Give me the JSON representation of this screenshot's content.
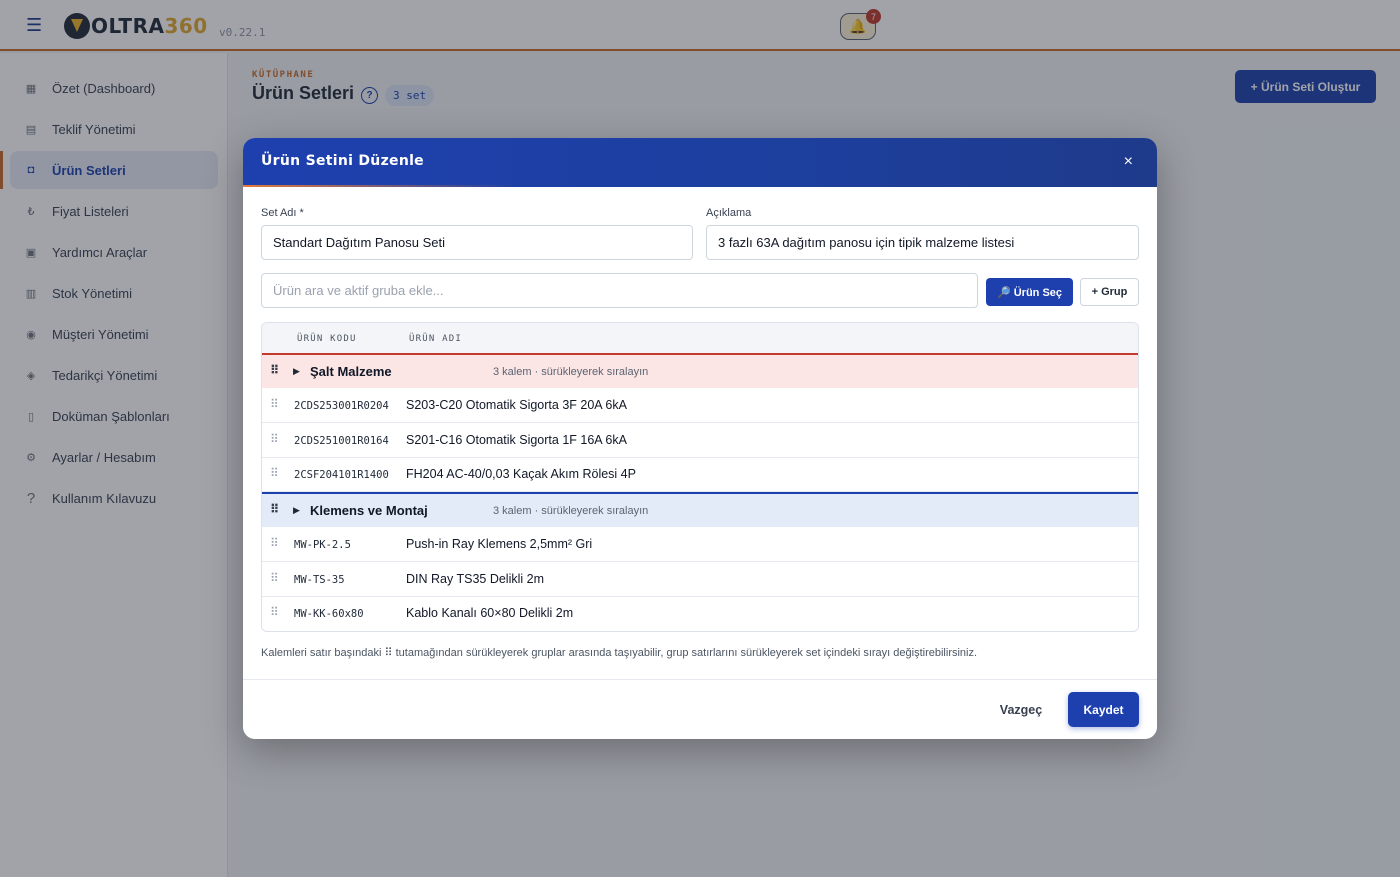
{
  "app": {
    "logo_prefix": "OLTRA",
    "logo_suffix": "360",
    "version": "v0.22.1",
    "notification_count": "7"
  },
  "sidebar": {
    "items": [
      {
        "label": "Özet (Dashboard)",
        "icon": "dashboard-icon",
        "active": false
      },
      {
        "label": "Teklif Yönetimi",
        "icon": "document-icon",
        "active": false
      },
      {
        "label": "Ürün Setleri",
        "icon": "box-icon",
        "active": true
      },
      {
        "label": "Fiyat Listeleri",
        "icon": "lira-icon",
        "active": false
      },
      {
        "label": "Yardımcı Araçlar",
        "icon": "toolbox-icon",
        "active": false
      },
      {
        "label": "Stok Yönetimi",
        "icon": "stock-icon",
        "active": false
      },
      {
        "label": "Müşteri Yönetimi",
        "icon": "customer-icon",
        "active": false
      },
      {
        "label": "Tedarikçi Yönetimi",
        "icon": "supplier-icon",
        "active": false
      },
      {
        "label": "Doküman Şablonları",
        "icon": "template-icon",
        "active": false
      },
      {
        "label": "Ayarlar / Hesabım",
        "icon": "settings-icon",
        "active": false
      },
      {
        "label": "Kullanım Kılavuzu",
        "icon": "question-icon",
        "active": false
      }
    ]
  },
  "page": {
    "eyebrow": "KÜTÜPHANE",
    "title": "Ürün Setleri",
    "help": "?",
    "count": "3 set",
    "create_button": "+ Ürün Seti Oluştur"
  },
  "modal": {
    "title": "Ürün Setini Düzenle",
    "close": "×",
    "set_name_label": "Set Adı *",
    "set_name_value": "Standart Dağıtım Panosu Seti",
    "description_label": "Açıklama",
    "description_value": "3 fazlı 63A dağıtım panosu için tipik malzeme listesi",
    "search_placeholder": "Ürün ara ve aktif gruba ekle...",
    "select_button": "🔎 Ürün Seç",
    "group_button": "+ Grup",
    "table": {
      "col_code": "ÜRÜN KODU",
      "col_name": "ÜRÜN ADI",
      "groups": [
        {
          "name": "Şalt Malzeme",
          "meta": "3 kalem · sürükleyerek sıralayın",
          "items": [
            {
              "code": "2CDS253001R0204",
              "name": "S203-C20 Otomatik Sigorta 3F 20A 6kA"
            },
            {
              "code": "2CDS251001R0164",
              "name": "S201-C16 Otomatik Sigorta 1F 16A 6kA"
            },
            {
              "code": "2CSF204101R1400",
              "name": "FH204 AC-40/0,03 Kaçak Akım Rölesi 4P"
            }
          ]
        },
        {
          "name": "Klemens ve Montaj",
          "meta": "3 kalem · sürükleyerek sıralayın",
          "items": [
            {
              "code": "MW-PK-2.5",
              "name": "Push-in Ray Klemens 2,5mm² Gri"
            },
            {
              "code": "MW-TS-35",
              "name": "DIN Ray TS35 Delikli 2m"
            },
            {
              "code": "MW-KK-60x80",
              "name": "Kablo Kanalı 60×80 Delikli 2m"
            }
          ]
        }
      ]
    },
    "hint": "Kalemleri satır başındaki ⠿ tutamağından sürükleyerek gruplar arasında taşıyabilir, grup satırlarını sürükleyerek set içindeki sırayı değiştirebilirsiniz.",
    "cancel_button": "Vazgeç",
    "save_button": "Kaydet"
  },
  "colors": {
    "primary": "#1e40af",
    "accent": "#c96a2a",
    "group_red_bg": "#fbe5e5",
    "group_blue_bg": "#e3ebf8"
  }
}
